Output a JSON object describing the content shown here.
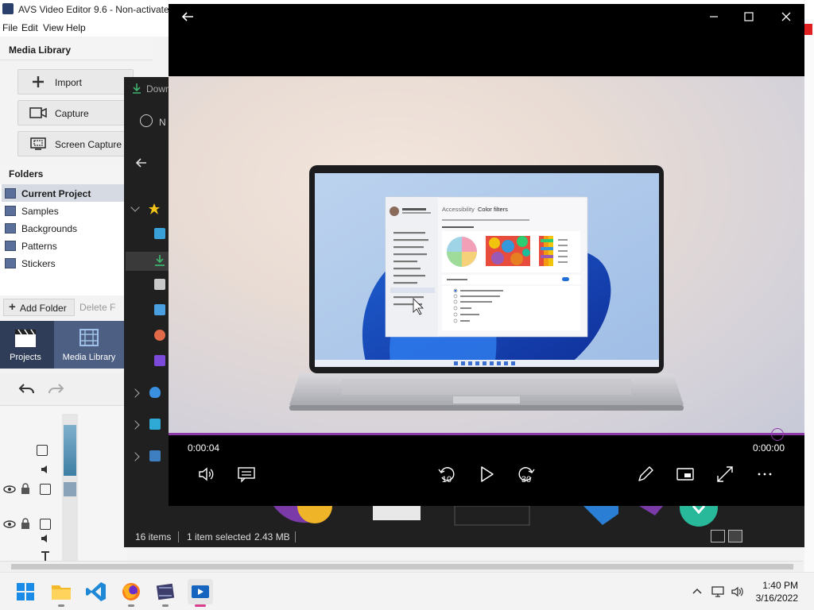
{
  "avs": {
    "title": "AVS Video Editor 9.6 - Non-activated",
    "menu": [
      "File",
      "Edit",
      "View",
      "Help"
    ],
    "media_library_title": "Media Library",
    "buttons": {
      "import": "Import",
      "capture": "Capture",
      "screen_capture": "Screen Capture"
    },
    "folders_title": "Folders",
    "folders": [
      "Current Project",
      "Samples",
      "Backgrounds",
      "Patterns",
      "Stickers"
    ],
    "add_folder": "Add Folder",
    "delete_folder": "Delete F",
    "tabs": {
      "projects": "Projects",
      "media_library": "Media Library"
    }
  },
  "explorer": {
    "title_partial": "Down",
    "new_partial": "N",
    "status": {
      "items": "16 items",
      "selected": "1 item selected",
      "size": "2.43 MB"
    }
  },
  "player": {
    "time_current": "0:00:04",
    "time_total": "0:00:00",
    "skip_back": "10",
    "skip_forward": "30",
    "progress_fraction": 1.0,
    "accent": "#8b3aa8"
  },
  "video": {
    "settings_title": "Accessibility",
    "settings_page": "Color filters"
  },
  "taskbar": {
    "time": "1:40 PM",
    "date": "3/16/2022",
    "apps": [
      "start-icon",
      "file-explorer-icon",
      "vscode-icon",
      "firefox-icon",
      "avs-editor-icon",
      "media-player-icon"
    ],
    "active_app": "media-player-icon"
  }
}
